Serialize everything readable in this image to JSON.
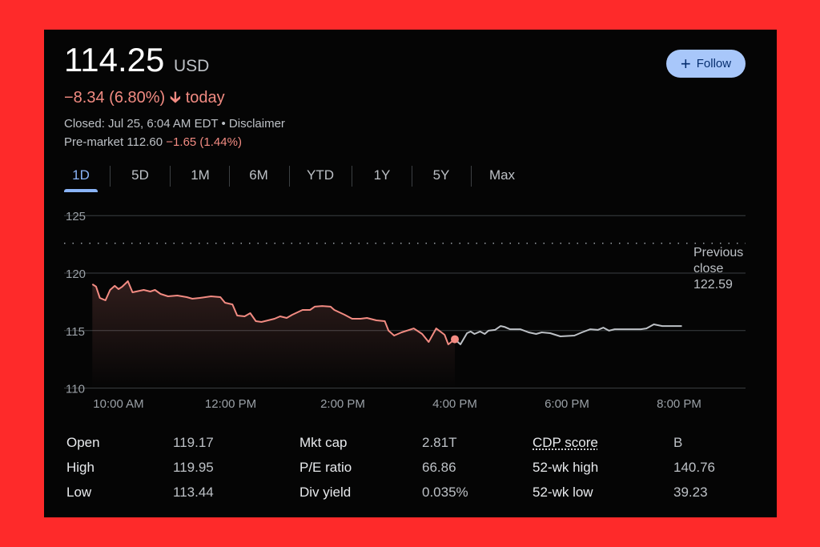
{
  "quote": {
    "price": "114.25",
    "currency": "USD",
    "change": "−8.34 (6.80%)",
    "change_arrow": "arrow-down-icon",
    "change_suffix": "today",
    "closed_text": "Closed: Jul 25, 6:04 AM EDT • ",
    "disclaimer": "Disclaimer",
    "premarket_label": "Pre-market 112.60",
    "premarket_change": "−1.65 (1.44%)"
  },
  "follow_button": {
    "label": "Follow",
    "icon": "plus-icon"
  },
  "tabs": [
    {
      "label": "1D",
      "active": true
    },
    {
      "label": "5D"
    },
    {
      "label": "1M"
    },
    {
      "label": "6M"
    },
    {
      "label": "YTD"
    },
    {
      "label": "1Y"
    },
    {
      "label": "5Y"
    },
    {
      "label": "Max"
    }
  ],
  "colors": {
    "down": "#f28b82",
    "after_hours": "#bdc1c6",
    "accent": "#8ab4f8",
    "follow_bg": "#a8c7fa",
    "background": "#fe2a2a"
  },
  "chart_data": {
    "type": "line",
    "y_ticks": [
      "110",
      "115",
      "120",
      "125"
    ],
    "x_ticks": [
      "10:00 AM",
      "12:00 PM",
      "2:00 PM",
      "4:00 PM",
      "6:00 PM",
      "8:00 PM"
    ],
    "ylim": [
      110,
      125
    ],
    "grid": true,
    "previous_close": {
      "label_line1": "Previous",
      "label_line2": "close",
      "value": "122.59"
    },
    "series": [
      {
        "session": "regular",
        "color": "#f28b82",
        "points": [
          [
            "9:32",
            119.03
          ],
          [
            "9:36",
            118.82
          ],
          [
            "9:40",
            117.84
          ],
          [
            "9:46",
            117.63
          ],
          [
            "9:51",
            118.54
          ],
          [
            "9:56",
            118.89
          ],
          [
            "10:00",
            118.61
          ],
          [
            "10:04",
            118.82
          ],
          [
            "10:10",
            119.3
          ],
          [
            "10:15",
            118.33
          ],
          [
            "10:23",
            118.47
          ],
          [
            "10:27",
            118.54
          ],
          [
            "10:34",
            118.4
          ],
          [
            "10:39",
            118.54
          ],
          [
            "10:45",
            118.19
          ],
          [
            "10:53",
            117.98
          ],
          [
            "11:03",
            118.05
          ],
          [
            "11:13",
            117.91
          ],
          [
            "11:19",
            117.77
          ],
          [
            "11:27",
            117.84
          ],
          [
            "11:39",
            117.98
          ],
          [
            "11:49",
            117.91
          ],
          [
            "11:54",
            117.42
          ],
          [
            "12:02",
            117.28
          ],
          [
            "12:07",
            116.31
          ],
          [
            "12:15",
            116.24
          ],
          [
            "12:21",
            116.52
          ],
          [
            "12:27",
            115.82
          ],
          [
            "12:33",
            115.75
          ],
          [
            "12:40",
            115.89
          ],
          [
            "12:47",
            116.03
          ],
          [
            "12:53",
            116.24
          ],
          [
            "13:00",
            116.1
          ],
          [
            "13:06",
            116.38
          ],
          [
            "13:17",
            116.8
          ],
          [
            "13:25",
            116.8
          ],
          [
            "13:30",
            117.08
          ],
          [
            "13:38",
            117.14
          ],
          [
            "13:47",
            117.08
          ],
          [
            "13:51",
            116.8
          ],
          [
            "14:02",
            116.38
          ],
          [
            "14:10",
            116.03
          ],
          [
            "14:19",
            116.03
          ],
          [
            "14:26",
            116.1
          ],
          [
            "14:36",
            115.89
          ],
          [
            "14:45",
            115.82
          ],
          [
            "14:49",
            114.99
          ],
          [
            "14:55",
            114.57
          ],
          [
            "15:03",
            114.85
          ],
          [
            "15:16",
            115.19
          ],
          [
            "15:25",
            114.71
          ],
          [
            "15:32",
            114.01
          ],
          [
            "15:40",
            115.19
          ],
          [
            "15:49",
            114.64
          ],
          [
            "15:53",
            113.8
          ],
          [
            "16:00",
            114.25
          ]
        ]
      },
      {
        "session": "after-hours",
        "color": "#bdc1c6",
        "points": [
          [
            "16:00",
            114.25
          ],
          [
            "16:06",
            113.8
          ],
          [
            "16:13",
            114.78
          ],
          [
            "16:17",
            114.92
          ],
          [
            "16:21",
            114.71
          ],
          [
            "16:27",
            114.92
          ],
          [
            "16:32",
            114.71
          ],
          [
            "16:36",
            114.99
          ],
          [
            "16:43",
            115.06
          ],
          [
            "16:49",
            115.4
          ],
          [
            "16:53",
            115.33
          ],
          [
            "16:59",
            115.12
          ],
          [
            "17:10",
            115.12
          ],
          [
            "17:19",
            114.85
          ],
          [
            "17:27",
            114.71
          ],
          [
            "17:33",
            114.85
          ],
          [
            "17:42",
            114.78
          ],
          [
            "17:53",
            114.5
          ],
          [
            "18:08",
            114.57
          ],
          [
            "18:16",
            114.85
          ],
          [
            "18:25",
            115.12
          ],
          [
            "18:33",
            115.06
          ],
          [
            "18:39",
            115.26
          ],
          [
            "18:45",
            114.99
          ],
          [
            "18:51",
            115.12
          ],
          [
            "19:08",
            115.12
          ],
          [
            "19:19",
            115.12
          ],
          [
            "19:25",
            115.19
          ],
          [
            "19:33",
            115.54
          ],
          [
            "19:42",
            115.4
          ],
          [
            "20:03",
            115.4
          ]
        ]
      }
    ],
    "close_marker": [
      "16:00",
      114.25
    ]
  },
  "stats": {
    "col1": [
      {
        "label": "Open",
        "value": "119.17"
      },
      {
        "label": "High",
        "value": "119.95"
      },
      {
        "label": "Low",
        "value": "113.44"
      }
    ],
    "col2": [
      {
        "label": "Mkt cap",
        "value": "2.81T"
      },
      {
        "label": "P/E ratio",
        "value": "66.86"
      },
      {
        "label": "Div yield",
        "value": "0.035%"
      }
    ],
    "col3": [
      {
        "label": "CDP score",
        "value": "B"
      },
      {
        "label": "52-wk high",
        "value": "140.76"
      },
      {
        "label": "52-wk low",
        "value": "39.23"
      }
    ]
  }
}
